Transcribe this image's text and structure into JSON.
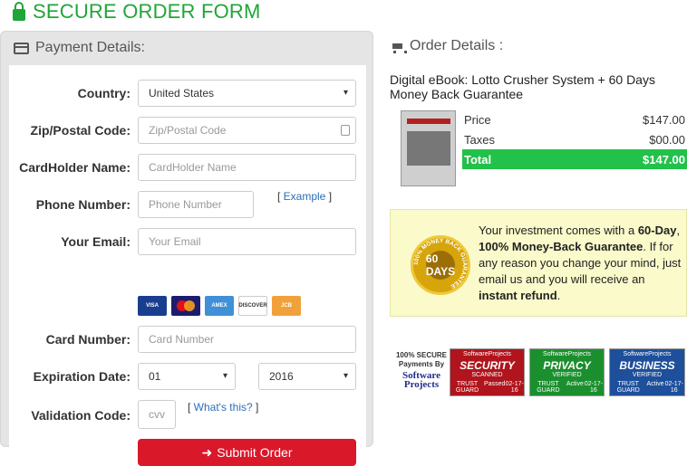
{
  "page_title": "SECURE ORDER FORM",
  "payment": {
    "heading": "Payment Details:",
    "country_label": "Country:",
    "country_value": "United States",
    "zip_label": "Zip/Postal Code:",
    "zip_placeholder": "Zip/Postal Code",
    "name_label": "CardHolder Name:",
    "name_placeholder": "CardHolder Name",
    "phone_label": "Phone Number:",
    "phone_placeholder": "Phone Number",
    "example_link": "Example",
    "email_label": "Your Email:",
    "email_placeholder": "Your Email",
    "card_label": "Card Number:",
    "card_placeholder": "Card Number",
    "exp_label": "Expiration Date:",
    "exp_month": "01",
    "exp_year": "2016",
    "cvv_label": "Validation Code:",
    "cvv_placeholder": "cvv",
    "whats_this": "What's this?",
    "submit_label": "Submit Order",
    "card_brands": [
      "VISA",
      "",
      "AMEX",
      "DISCOVER",
      "JCB"
    ]
  },
  "order": {
    "heading": "Order Details :",
    "product": "Digital eBook: Lotto Crusher System + 60 Days Money Back Guarantee",
    "rows": [
      {
        "label": "Price",
        "value": "$147.00"
      },
      {
        "label": "Taxes",
        "value": "$00.00"
      },
      {
        "label": "Total",
        "value": "$147.00"
      }
    ]
  },
  "guarantee": {
    "seal_text": "60 DAYS",
    "seal_ring": "100% MONEY BACK GUARANTEE",
    "text_1": "Your investment comes with a ",
    "bold_1": "60-Day",
    "text_2": ", ",
    "bold_2": "100% Money-Back Guarantee",
    "text_3": ". If for any reason you change your mind, just email us and you will receive an ",
    "bold_3": "instant refund",
    "text_4": "."
  },
  "badges": {
    "secure_text": "100% SECURE Payments By",
    "secure_brand": "Software Projects",
    "items": [
      {
        "top": "SoftwareProjects",
        "title": "SECURITY",
        "sub": "SCANNED",
        "foot": "TRUST GUARD",
        "status": "Passed",
        "date": "02-17-16",
        "color": "#b0141c"
      },
      {
        "top": "SoftwareProjects",
        "title": "PRIVACY",
        "sub": "VERIFIED",
        "foot": "TRUST GUARD",
        "status": "Active",
        "date": "02-17-16",
        "color": "#1b8f2e"
      },
      {
        "top": "SoftwareProjects",
        "title": "BUSINESS",
        "sub": "VERIFIED",
        "foot": "TRUST GUARD",
        "status": "Active",
        "date": "02-17-16",
        "color": "#1e4f9b"
      }
    ]
  }
}
